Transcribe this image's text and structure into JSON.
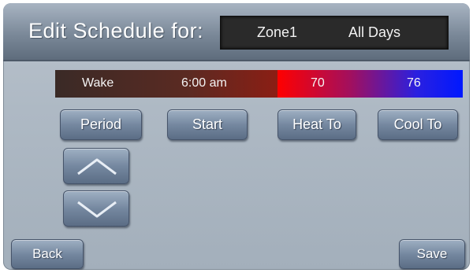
{
  "header": {
    "title": "Edit Schedule for:",
    "zone": "Zone1",
    "days": "All Days"
  },
  "schedule_row": {
    "period": "Wake",
    "start": "6:00 am",
    "heat_to": "70",
    "cool_to": "76"
  },
  "columns": {
    "period_label": "Period",
    "start_label": "Start",
    "heat_label": "Heat To",
    "cool_label": "Cool To"
  },
  "navigation": {
    "up_icon": "chevron-up-icon",
    "down_icon": "chevron-down-icon"
  },
  "footer": {
    "back_label": "Back",
    "save_label": "Save"
  },
  "colors": {
    "heat": "#ff0000",
    "cool": "#0018ff",
    "period_bar": "#6b2a22"
  }
}
